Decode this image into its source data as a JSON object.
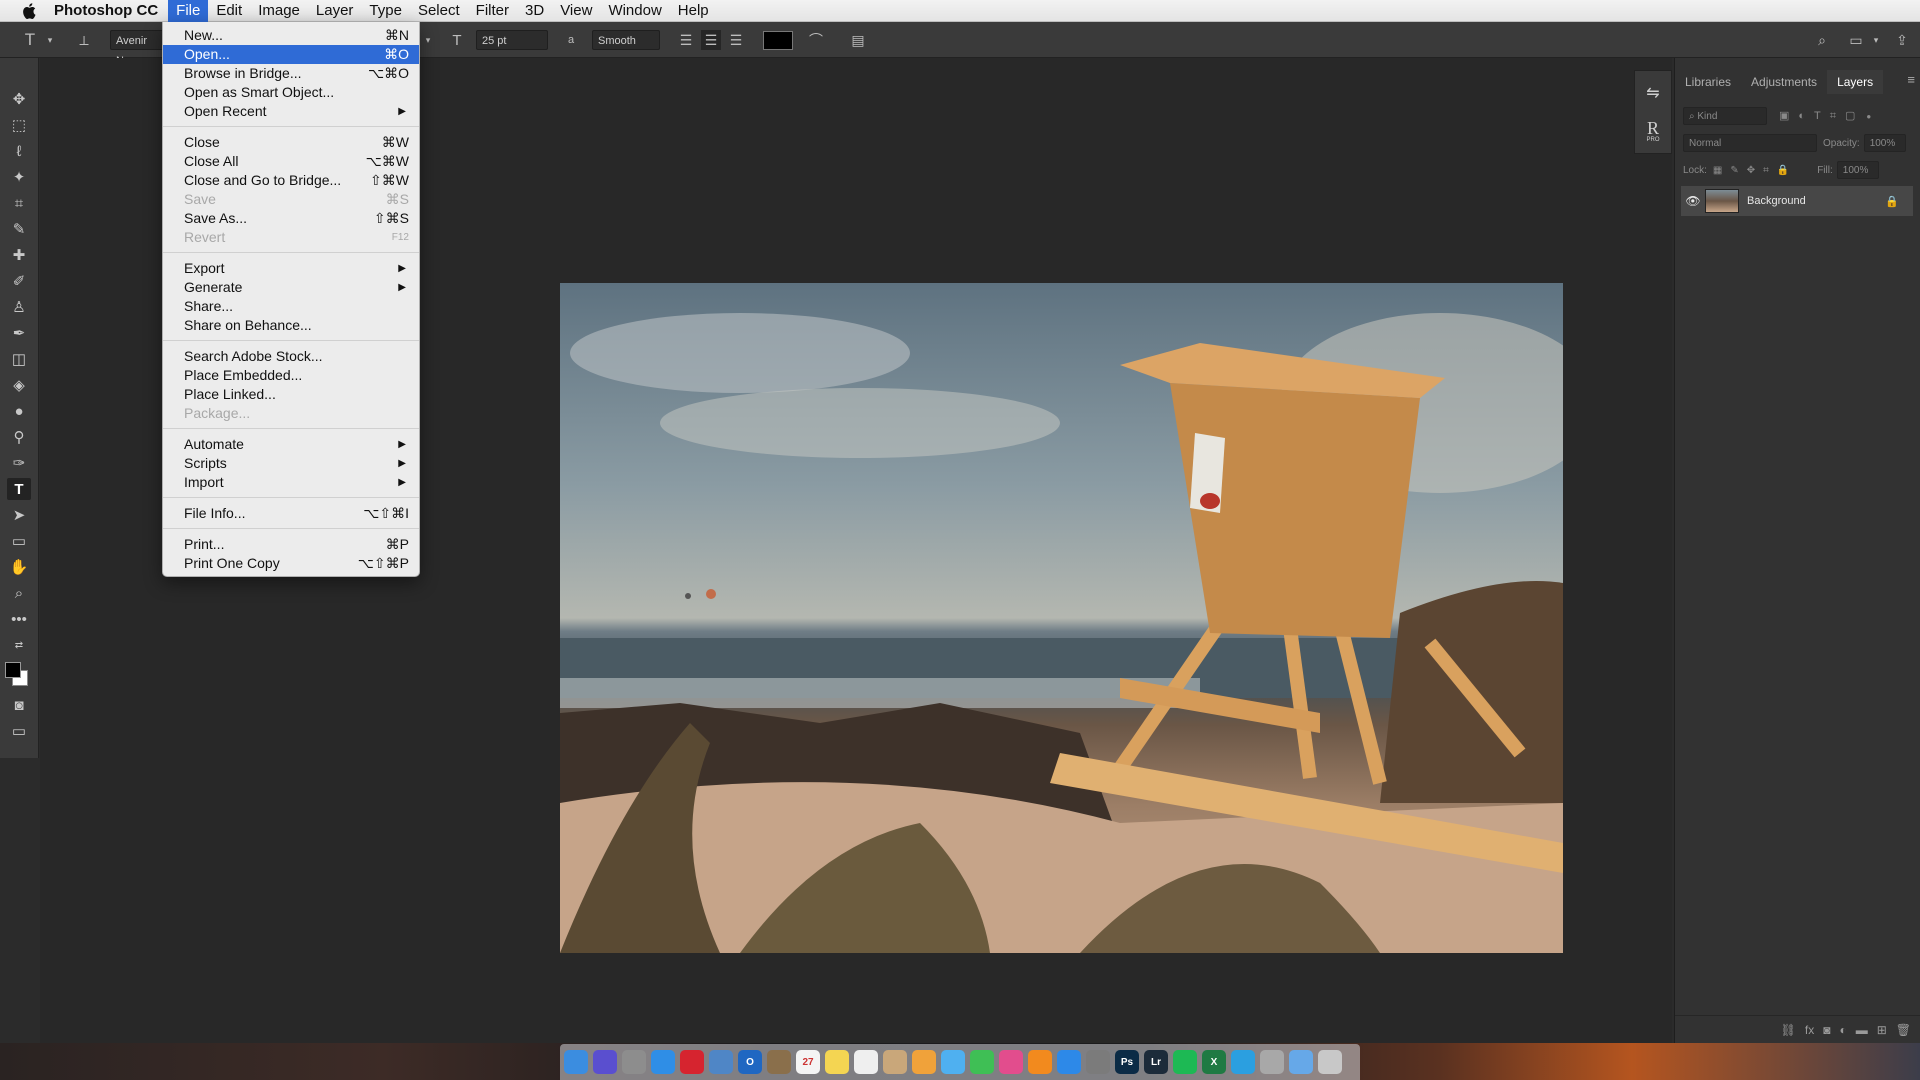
{
  "menubar": {
    "app_name": "Photoshop CC",
    "items": [
      "File",
      "Edit",
      "Image",
      "Layer",
      "Type",
      "Select",
      "Filter",
      "3D",
      "View",
      "Window",
      "Help"
    ],
    "active": "File"
  },
  "options_bar": {
    "font_family": "Avenir Ne",
    "font_size": "25 pt",
    "anti_alias": "Smooth",
    "text_color": "#000000"
  },
  "file_menu": {
    "items": [
      {
        "label": "New...",
        "shortcut": "⌘N"
      },
      {
        "label": "Open...",
        "shortcut": "⌘O",
        "highlight": true
      },
      {
        "label": "Browse in Bridge...",
        "shortcut": "⌥⌘O"
      },
      {
        "label": "Open as Smart Object...",
        "shortcut": ""
      },
      {
        "label": "Open Recent",
        "submenu": true
      },
      {
        "label": "Close",
        "shortcut": "⌘W"
      },
      {
        "label": "Close All",
        "shortcut": "⌥⌘W"
      },
      {
        "label": "Close and Go to Bridge...",
        "shortcut": "⇧⌘W"
      },
      {
        "label": "Save",
        "shortcut": "⌘S",
        "disabled": true
      },
      {
        "label": "Save As...",
        "shortcut": "⇧⌘S"
      },
      {
        "label": "Revert",
        "shortcut": "F12",
        "disabled": true
      },
      {
        "label": "Export",
        "submenu": true
      },
      {
        "label": "Generate",
        "submenu": true
      },
      {
        "label": "Share...",
        "shortcut": ""
      },
      {
        "label": "Share on Behance...",
        "shortcut": ""
      },
      {
        "label": "Search Adobe Stock...",
        "shortcut": ""
      },
      {
        "label": "Place Embedded...",
        "shortcut": ""
      },
      {
        "label": "Place Linked...",
        "shortcut": ""
      },
      {
        "label": "Package...",
        "shortcut": "",
        "disabled": true
      },
      {
        "label": "Automate",
        "submenu": true
      },
      {
        "label": "Scripts",
        "submenu": true
      },
      {
        "label": "Import",
        "submenu": true
      },
      {
        "label": "File Info...",
        "shortcut": "⌥⇧⌘I"
      },
      {
        "label": "Print...",
        "shortcut": "⌘P"
      },
      {
        "label": "Print One Copy",
        "shortcut": "⌥⇧⌘P"
      }
    ],
    "arrow": "▶"
  },
  "panels": {
    "tabs": [
      "Libraries",
      "Adjustments",
      "Layers"
    ],
    "active_tab": "Layers",
    "filter_kind": "Kind",
    "blend_mode": "Normal",
    "opacity_label": "Opacity:",
    "opacity_value": "100%",
    "lock_label": "Lock:",
    "fill_label": "Fill:",
    "fill_value": "100%",
    "layer_name": "Background",
    "strip_r": "R",
    "strip_pro": "PRO"
  },
  "dock": {
    "icons": [
      {
        "name": "finder-icon",
        "color": "#3b8de0",
        "glyph": ""
      },
      {
        "name": "siri-icon",
        "color": "#5a4fcf",
        "glyph": ""
      },
      {
        "name": "launchpad-icon",
        "color": "#8d8d8d",
        "glyph": ""
      },
      {
        "name": "safari-icon",
        "color": "#2f8ee6",
        "glyph": ""
      },
      {
        "name": "opera-icon",
        "color": "#d6242f",
        "glyph": ""
      },
      {
        "name": "preview-icon",
        "color": "#4f86c6",
        "glyph": ""
      },
      {
        "name": "outlook-icon",
        "color": "#1f67c2",
        "glyph": "O"
      },
      {
        "name": "notes-app-icon",
        "color": "#8a6f4b",
        "glyph": ""
      },
      {
        "name": "calendar-icon",
        "color": "#f4f4f4",
        "glyph": "27"
      },
      {
        "name": "notes-icon",
        "color": "#f4d552",
        "glyph": ""
      },
      {
        "name": "reminders-icon",
        "color": "#efefef",
        "glyph": ""
      },
      {
        "name": "contacts-icon",
        "color": "#c9a77a",
        "glyph": ""
      },
      {
        "name": "photos-icon",
        "color": "#f0a23a",
        "glyph": ""
      },
      {
        "name": "messages-icon",
        "color": "#4fb0f0",
        "glyph": ""
      },
      {
        "name": "facetime-icon",
        "color": "#3fbf55",
        "glyph": ""
      },
      {
        "name": "itunes-icon",
        "color": "#e24d8d",
        "glyph": ""
      },
      {
        "name": "ibooks-icon",
        "color": "#f28a1e",
        "glyph": ""
      },
      {
        "name": "app-store-icon",
        "color": "#2d89e8",
        "glyph": ""
      },
      {
        "name": "system-preferences-icon",
        "color": "#7b7b7b",
        "glyph": ""
      },
      {
        "name": "photoshop-icon",
        "color": "#0b2b46",
        "glyph": "Ps"
      },
      {
        "name": "lightroom-icon",
        "color": "#1c2b3a",
        "glyph": "Lr"
      },
      {
        "name": "spotify-icon",
        "color": "#1db954",
        "glyph": ""
      },
      {
        "name": "excel-icon",
        "color": "#1f7a43",
        "glyph": "X"
      },
      {
        "name": "skype-icon",
        "color": "#2b9fe0",
        "glyph": ""
      },
      {
        "name": "storage-icon",
        "color": "#a8a8a8",
        "glyph": ""
      },
      {
        "name": "downloads-folder-icon",
        "color": "#66a8e8",
        "glyph": ""
      },
      {
        "name": "trash-icon",
        "color": "#c8c8c8",
        "glyph": ""
      }
    ]
  }
}
